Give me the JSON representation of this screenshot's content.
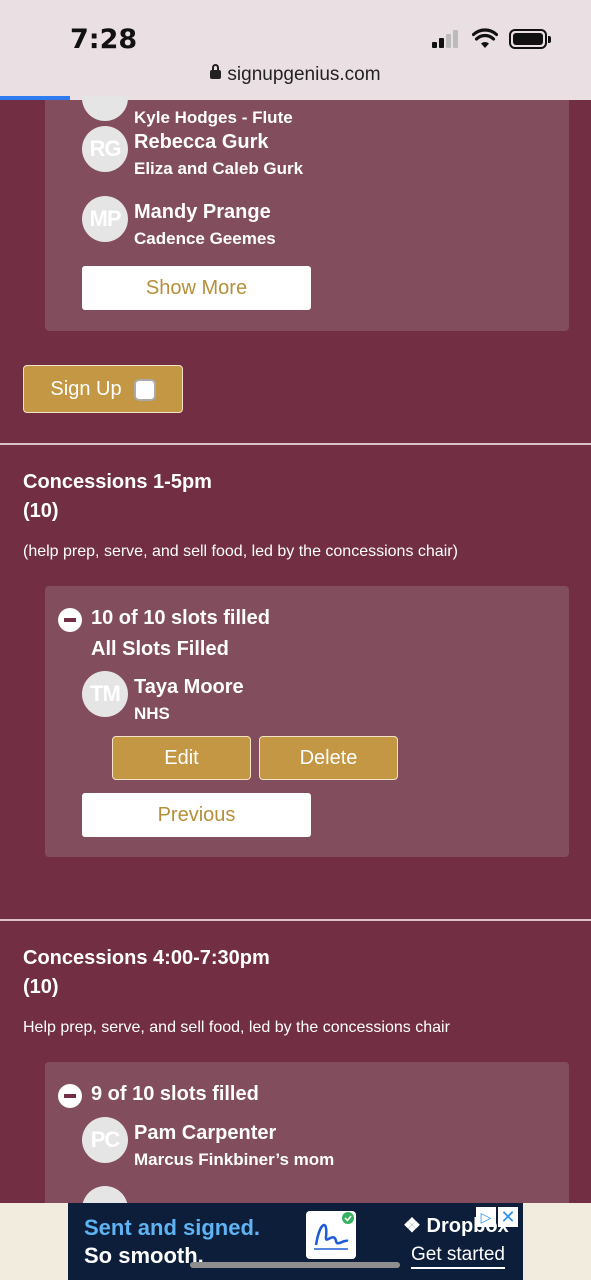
{
  "status_bar": {
    "time": "7:28",
    "url": "signupgenius.com"
  },
  "top_list": {
    "partial_person": {
      "sub": "Kyle Hodges - Flute"
    },
    "people": [
      {
        "initials": "RG",
        "name": "Rebecca Gurk",
        "sub": "Eliza and Caleb Gurk"
      },
      {
        "initials": "MP",
        "name": "Mandy Prange",
        "sub": "Cadence Geemes"
      }
    ],
    "show_more_label": "Show More"
  },
  "sign_up": {
    "label": "Sign Up"
  },
  "sections": [
    {
      "title_line1": "Concessions 1-5pm",
      "title_line2": "(10)",
      "description": "(help prep, serve, and sell food, led by the concessions chair)",
      "slots_filled": "10 of 10 slots filled",
      "status": "All Slots Filled",
      "people": [
        {
          "initials": "TM",
          "name": "Taya Moore",
          "sub": "NHS"
        }
      ],
      "edit_label": "Edit",
      "delete_label": "Delete",
      "previous_label": "Previous"
    },
    {
      "title_line1": "Concessions 4:00-7:30pm",
      "title_line2": "(10)",
      "description": "Help prep, serve, and sell food, led by the concessions chair",
      "slots_filled": "9 of 10 slots filled",
      "people": [
        {
          "initials": "PC",
          "name": "Pam Carpenter",
          "sub": "Marcus Finkbiner’s mom"
        }
      ]
    }
  ],
  "ad": {
    "line1": "Sent and signed.",
    "line2": "So smooth.",
    "brand": "Dropbox",
    "cta": "Get started"
  },
  "colors": {
    "background": "#722f43",
    "panel": "#824d5c",
    "gold": "#c39744"
  }
}
